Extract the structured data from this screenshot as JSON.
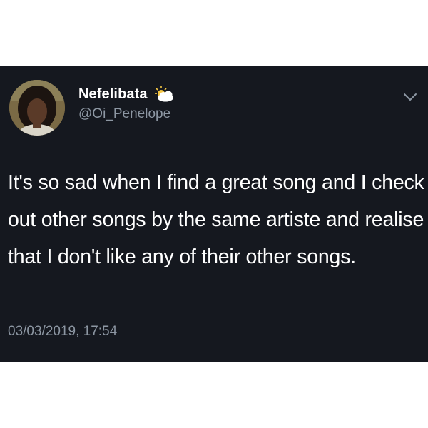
{
  "tweet": {
    "author": {
      "display_name": "Nefelibata",
      "handle": "@Oi_Penelope",
      "name_emoji_icon": "sun-behind-cloud-icon"
    },
    "text": "It's so sad when I find a great song and I check out other songs by the same artiste and realise that I don't like any of their other songs.",
    "timestamp": "03/03/2019, 17:54",
    "menu_icon": "chevron-down-icon"
  },
  "colors": {
    "card_background": "#15181f",
    "primary_text": "#ffffff",
    "secondary_text": "#8d97a3"
  }
}
